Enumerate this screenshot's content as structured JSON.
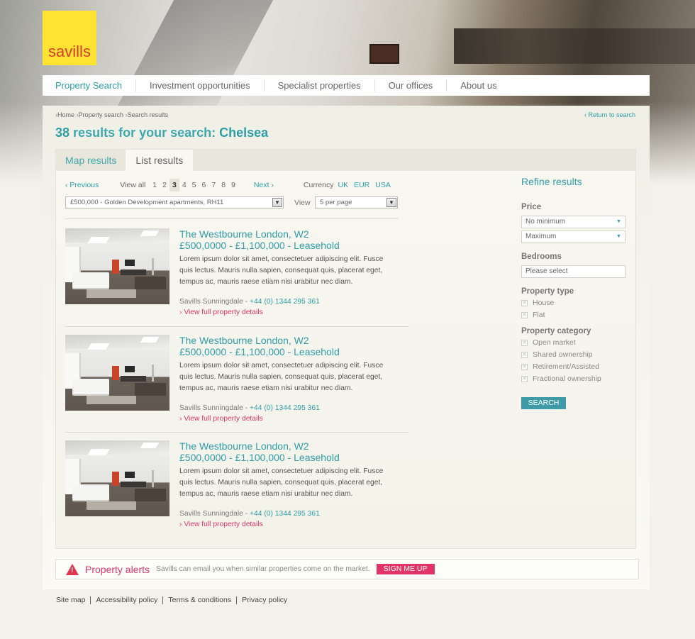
{
  "brand": {
    "logo_text": "savills"
  },
  "nav": {
    "items": [
      "Property Search",
      "Investment opportunities",
      "Specialist properties",
      "Our offices",
      "About us"
    ]
  },
  "breadcrumb": {
    "home": "Home",
    "property_search": "Property search",
    "search_results": "Search results",
    "return_link": "Return to search"
  },
  "results": {
    "count": "38",
    "text": "results for your search:",
    "query": "Chelsea"
  },
  "tabs": [
    "Map results",
    "List results"
  ],
  "pager": {
    "previous": "Previous",
    "view_all": "View all",
    "pages": [
      "1",
      "2",
      "3",
      "4",
      "5",
      "6",
      "7",
      "8",
      "9"
    ],
    "current_page": "3",
    "next": "Next",
    "currency_label": "Currency",
    "currencies": [
      "UK",
      "EUR",
      "USA"
    ]
  },
  "filters": {
    "development_select": "£500,000 - Golden Development apartments, RH11",
    "view_label": "View",
    "per_page_select": "5 per page"
  },
  "listings": [
    {
      "title": "The Westbourne London, W2",
      "price": "£500,0000 - £1,100,000 - Leasehold",
      "description": "Lorem ipsum dolor sit amet, consectetuer adipiscing elit. Fusce quis lectus. Mauris nulla sapien, consequat quis, placerat eget, tempus ac, mauris raese etiam nisi urabitur nec diam.",
      "agent": "Savills Sunningdale - ",
      "phone": "+44 (0) 1344 295 361",
      "details_link": "View full property details"
    },
    {
      "title": "The Westbourne London, W2",
      "price": "£500,0000 - £1,100,000 - Leasehold",
      "description": "Lorem ipsum dolor sit amet, consectetuer adipiscing elit. Fusce quis lectus. Mauris nulla sapien, consequat quis, placerat eget, tempus ac, mauris raese etiam nisi urabitur nec diam.",
      "agent": "Savills Sunningdale - ",
      "phone": "+44 (0) 1344 295 361",
      "details_link": "View full property details"
    },
    {
      "title": "The Westbourne London, W2",
      "price": "£500,0000 - £1,100,000 - Leasehold",
      "description": "Lorem ipsum dolor sit amet, consectetuer adipiscing elit. Fusce quis lectus. Mauris nulla sapien, consequat quis, placerat eget, tempus ac, mauris raese etiam nisi urabitur nec diam.",
      "agent": "Savills Sunningdale - ",
      "phone": "+44 (0) 1344 295 361",
      "details_link": "View full property details"
    }
  ],
  "refine": {
    "heading": "Refine results",
    "price_label": "Price",
    "price_min": "No minimum",
    "price_max": "Maximum",
    "bedrooms_label": "Bedrooms",
    "bedrooms_placeholder": "Please select",
    "type_label": "Property type",
    "types": [
      "House",
      "Flat"
    ],
    "category_label": "Property category",
    "categories": [
      "Open market",
      "Shared ownership",
      "Retirement/Assisted",
      "Fractional ownership"
    ],
    "search_button": "SEARCH"
  },
  "alerts": {
    "title": "Property alerts",
    "text": "Savills can email you when similar properties come on the market.",
    "button": "SIGN ME UP"
  },
  "footer": [
    "Site map",
    "Accessibility policy",
    "Terms & conditions",
    "Privacy policy"
  ],
  "colors": {
    "accent": "#2d9ea8",
    "pink": "#e0346a",
    "logo_bg": "#ffe332",
    "logo_text": "#d63b2d"
  }
}
